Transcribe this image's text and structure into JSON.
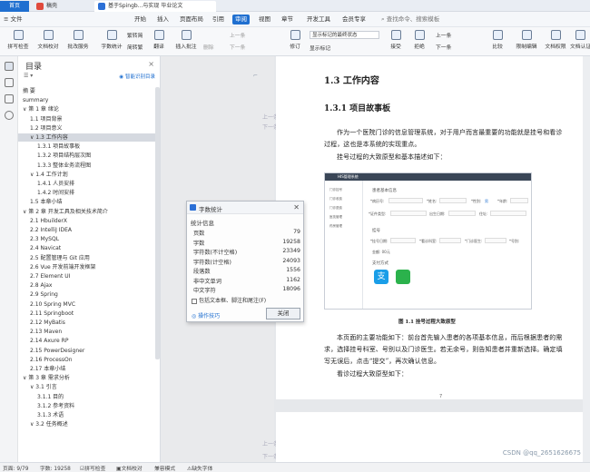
{
  "tabs": {
    "home": "首页",
    "doc1": "稿壳",
    "doc2": "基于Spingb...与实现 毕业论文"
  },
  "menu": {
    "file": "文件",
    "items": [
      "开始",
      "插入",
      "页面布局",
      "引用",
      "审阅",
      "视图",
      "章节",
      "开发工具",
      "会员专享"
    ],
    "active": "审阅",
    "search": "查找命令、搜索模板"
  },
  "toolbar": {
    "spellcheck": "拼写检查",
    "doccheck": "文档校对",
    "batchservice": "批改服务",
    "wordcount": "字数统计",
    "trans_simp": "繁转简",
    "trans_trad": "简转繁",
    "translate": "翻译",
    "newcomment": "插入批注",
    "delete": "删除",
    "prev": "上一条",
    "next": "下一条",
    "modify": "修订",
    "showmarkup_dd": "显示标记的最终状态",
    "showmarkup": "显示标记",
    "accept": "接受",
    "reject": "拒绝",
    "prev2": "上一条",
    "next2": "下一条",
    "compare": "比较",
    "restrict": "限制编辑",
    "docperm": "文档权限",
    "docauth": "文档认证"
  },
  "nav": {
    "title": "目录",
    "smart": "智能识别目录",
    "items": [
      {
        "label": "摘 要",
        "indent": 0
      },
      {
        "label": "summary",
        "indent": 0
      },
      {
        "label": "∨ 第 1 章 绪论",
        "indent": 0
      },
      {
        "label": "1.1 项目背景",
        "indent": 1
      },
      {
        "label": "1.2 项目意义",
        "indent": 1
      },
      {
        "label": "∨ 1.3 工作内容",
        "indent": 1,
        "selected": true
      },
      {
        "label": "1.3.1 项目故事板",
        "indent": 2
      },
      {
        "label": "1.3.2 项目结构层次图",
        "indent": 2
      },
      {
        "label": "1.3.3 整体业务流程图",
        "indent": 2
      },
      {
        "label": "∨ 1.4 工作计划",
        "indent": 1
      },
      {
        "label": "1.4.1 人员安排",
        "indent": 2
      },
      {
        "label": "1.4.2 时间安排",
        "indent": 2
      },
      {
        "label": "1.5 本章小结",
        "indent": 1
      },
      {
        "label": "∨ 第 2 章 开发工具及相关技术简介",
        "indent": 0
      },
      {
        "label": "2.1 HbuilderX",
        "indent": 1
      },
      {
        "label": "2.2 IntelliJ IDEA",
        "indent": 1
      },
      {
        "label": "2.3 MySQL",
        "indent": 1
      },
      {
        "label": "2.4 Navicat",
        "indent": 1
      },
      {
        "label": "2.5 配置管理与 Git 应用",
        "indent": 1
      },
      {
        "label": "2.6 Vue 开发前端开发框架",
        "indent": 1
      },
      {
        "label": "2.7 Element UI",
        "indent": 1
      },
      {
        "label": "2.8 Ajax",
        "indent": 1
      },
      {
        "label": "2.9 Spring",
        "indent": 1
      },
      {
        "label": "2.10 Spring MVC",
        "indent": 1
      },
      {
        "label": "2.11 Springboot",
        "indent": 1
      },
      {
        "label": "2.12 MyBatis",
        "indent": 1
      },
      {
        "label": "2.13 Maven",
        "indent": 1
      },
      {
        "label": "2.14 Axure RP",
        "indent": 1
      },
      {
        "label": "2.15 PowerDesigner",
        "indent": 1
      },
      {
        "label": "2.16 ProcessOn",
        "indent": 1
      },
      {
        "label": "2.17 本章小结",
        "indent": 1
      },
      {
        "label": "∨ 第 3 章 需求分析",
        "indent": 0
      },
      {
        "label": "∨ 3.1 引言",
        "indent": 1
      },
      {
        "label": "3.1.1 目的",
        "indent": 2
      },
      {
        "label": "3.1.2 参考资料",
        "indent": 2
      },
      {
        "label": "3.1.3 术语",
        "indent": 2
      },
      {
        "label": "∨ 3.2 任务概述",
        "indent": 1
      }
    ]
  },
  "doc": {
    "h2": "1.3 工作内容",
    "h3": "1.3.1 项目故事板",
    "p1a": "作为一个医院门诊的信息管理系统，对于用户而言最重要的功能就是挂号和看诊",
    "p1b": "过程，这也是本系统的实现重点。",
    "p2": "挂号过程的大致原型和基本描述如下：",
    "caption": "图 1.1 挂号过程大致原型",
    "p3a": "本页面的主要功能如下：前台首先输入患者的各项基本信息，而后根据患者的需",
    "p3b": "求，选择挂号科室、号别以及门诊医生。若无余号，则告知患者并重新选择。确定填",
    "p3c": "写无误后，点击“提交”，再次确认信息。",
    "p4": "看诊过程大致原型如下：",
    "pageno": "7",
    "figure": {
      "header": "HIS管理系统",
      "side": [
        "门诊挂号",
        "门诊收费",
        "门诊退费",
        "医技管理",
        "药房管理"
      ],
      "sec1": "患者基本信息",
      "labels": [
        "*病历号:",
        "*姓名:",
        "*性别:",
        "*年龄:",
        "*证件类型:",
        "*证件号:",
        "出生日期:",
        "住址:",
        "*挂号日期:",
        "*看诊科室:",
        "*门诊医生:",
        "*号别:"
      ],
      "sec2": "挂号",
      "sec3": "支付方式",
      "male": "男",
      "fee": "金额: 00元"
    }
  },
  "margin_marks": [
    "上一条",
    "下一条",
    "上一条",
    "下一条",
    "上一条",
    "下一条"
  ],
  "dialog": {
    "title": "字数统计",
    "section": "统计信息",
    "rows": [
      {
        "k": "页数",
        "v": "79"
      },
      {
        "k": "字数",
        "v": "19258"
      },
      {
        "k": "字符数(不计空格)",
        "v": "23349"
      },
      {
        "k": "字符数(计空格)",
        "v": "24093"
      },
      {
        "k": "段落数",
        "v": "1556"
      },
      {
        "k": "非中文单词",
        "v": "1162"
      },
      {
        "k": "中文字符",
        "v": "18096"
      }
    ],
    "checkbox": "包括文本框、脚注和尾注(F)",
    "tips": "操作技巧",
    "close": "关闭"
  },
  "status": {
    "page": "页面: 9/79",
    "words": "字数: 19258",
    "spell": "拼写检查",
    "proof": "文档校对",
    "compat": "兼容模式",
    "font": "缺失字体"
  },
  "watermark": "CSDN @qq_2651626675",
  "colors": {
    "accent": "#1f6fd0",
    "dark_header": "#3a4657"
  }
}
